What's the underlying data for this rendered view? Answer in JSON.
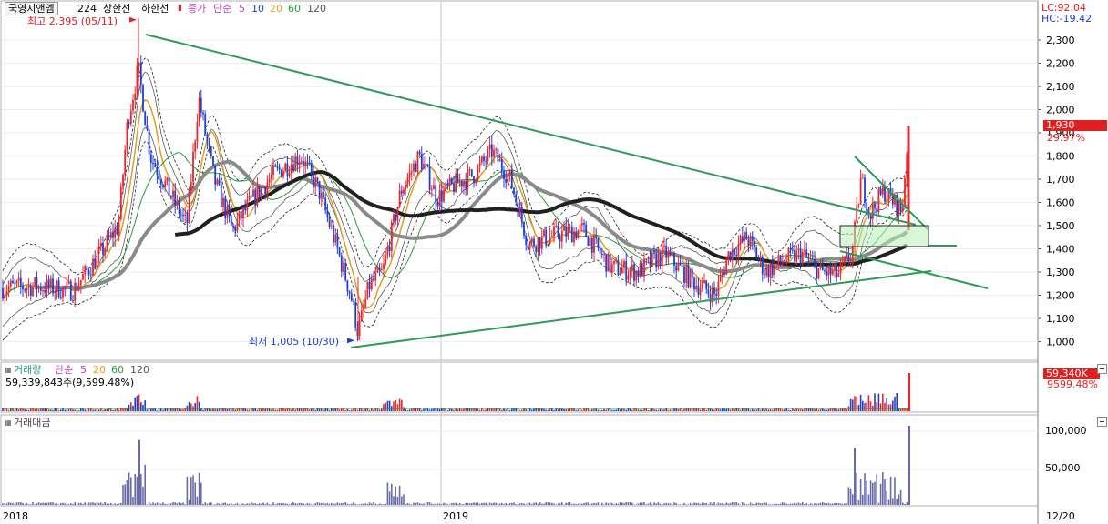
{
  "header": {
    "stock_name": "국영지앤엠",
    "period": "224",
    "upper_band": "상한선",
    "lower_band": "하한선",
    "price_label": "종가",
    "ma_type": "단순",
    "ma_periods": [
      "5",
      "10",
      "20",
      "60",
      "120"
    ],
    "lc": "LC:92.04",
    "hc": "HC:-19.42"
  },
  "annotations": {
    "high": "최고 2,395 (05/11)",
    "low": "최저 1,005 (10/30)"
  },
  "price_panel": {
    "last_price": "1,930",
    "change_pct": "29.97%",
    "y_ticks": [
      "2,300",
      "2,200",
      "2,100",
      "2,000",
      "1,900",
      "1,800",
      "1,700",
      "1,600",
      "1,500",
      "1,400",
      "1,300",
      "1,200",
      "1,100",
      "1,000"
    ]
  },
  "volume_panel": {
    "title": "거래량",
    "ma_type": "단순",
    "ma_periods": [
      "5",
      "20",
      "60",
      "120"
    ],
    "current": "59,339,843주(9,599.48%)",
    "last_tag": "59,340K",
    "last_pct": "9599.48%"
  },
  "amount_panel": {
    "title": "거래대금",
    "y_ticks": [
      "100,000",
      "50,000"
    ]
  },
  "x_axis": {
    "labels": [
      "2018",
      "2019"
    ],
    "right_label": "12/20"
  },
  "colors": {
    "up": "#e8262b",
    "down": "#1f3fd0",
    "ma5": "#c040c0",
    "ma10": "#1f3fd0",
    "ma20": "#e0a020",
    "ma60": "#2a9a3a",
    "ma120": "#202020",
    "trend": "#2f9a55",
    "gray_ma": "#8a8a8a",
    "amount_bar": "#6a6aa8"
  },
  "chart_data": {
    "type": "candlestick",
    "xlim": [
      "2018-01",
      "2019-12-20"
    ],
    "ylim": [
      950,
      2400
    ],
    "price_ticks": [
      1000,
      1100,
      1200,
      1300,
      1400,
      1500,
      1600,
      1700,
      1800,
      1900,
      2000,
      2100,
      2200,
      2300
    ],
    "high": {
      "value": 2395,
      "date": "05/11"
    },
    "low": {
      "value": 1005,
      "date": "10/30"
    },
    "last_close": 1930,
    "last_change_pct": 29.97,
    "trend_lines": [
      {
        "name": "upper",
        "points": [
          [
            0.02,
            2320
          ],
          [
            0.64,
            1430
          ]
        ]
      },
      {
        "name": "lower",
        "points": [
          [
            0.29,
            980
          ],
          [
            0.78,
            1305
          ]
        ]
      },
      {
        "name": "lower-ext",
        "points": [
          [
            0.72,
            1420
          ],
          [
            0.92,
            1220
          ]
        ]
      }
    ],
    "amount_ylim": [
      0,
      110000
    ],
    "amount_ticks": [
      50000,
      100000
    ]
  }
}
